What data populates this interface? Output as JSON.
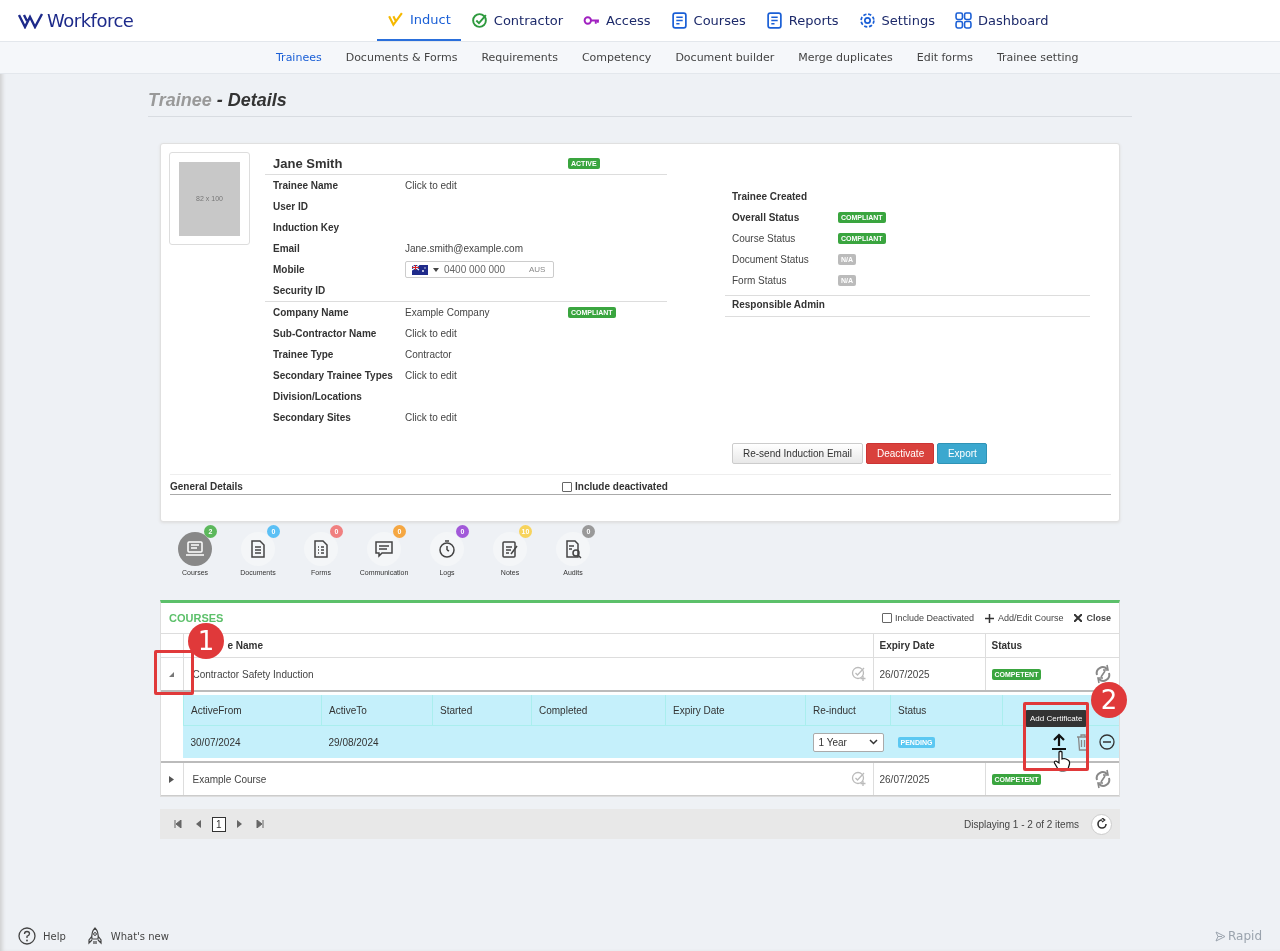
{
  "app": {
    "logo": "Workforce",
    "nav": [
      {
        "label": "Induct",
        "selected": true
      },
      {
        "label": "Contractor",
        "selected": false
      },
      {
        "label": "Access",
        "selected": false
      },
      {
        "label": "Courses",
        "selected": false
      },
      {
        "label": "Reports",
        "selected": false
      },
      {
        "label": "Settings",
        "selected": false
      },
      {
        "label": "Dashboard",
        "selected": false
      }
    ],
    "subnav": [
      {
        "label": "Trainees",
        "selected": true
      },
      {
        "label": "Documents & Forms",
        "selected": false
      },
      {
        "label": "Requirements",
        "selected": false
      },
      {
        "label": "Competency",
        "selected": false
      },
      {
        "label": "Document builder",
        "selected": false
      },
      {
        "label": "Merge duplicates",
        "selected": false
      },
      {
        "label": "Edit forms",
        "selected": false
      },
      {
        "label": "Trainee setting",
        "selected": false
      }
    ]
  },
  "page_title": {
    "main": "Trainee",
    "suffix": "- Details"
  },
  "profile": {
    "photo_placeholder": "82 x 100",
    "name": "Jane Smith",
    "status": "ACTIVE",
    "fields_primary": [
      {
        "label": "Trainee Name",
        "kind": "text",
        "value": "Click to edit"
      },
      {
        "label": "User ID",
        "kind": "text"
      },
      {
        "label": "Induction Key",
        "kind": "text"
      },
      {
        "label": "Email",
        "kind": "text",
        "value": "Jane.smith@example.com"
      },
      {
        "label": "Mobile",
        "kind": "phone",
        "placeholder": "0400 000 000",
        "country": "AUS"
      },
      {
        "label": "Security ID",
        "kind": "text"
      }
    ],
    "fields_secondary": [
      {
        "label": "Company Name",
        "value": "Example Company",
        "badge": "COMPLIANT"
      },
      {
        "label": "Sub-Contractor Name",
        "value": "Click to edit"
      },
      {
        "label": "Trainee Type",
        "value": "Contractor"
      },
      {
        "label": "Secondary Trainee Types",
        "value": "Click to edit"
      },
      {
        "label": "Division/Locations"
      },
      {
        "label": "Secondary Sites",
        "value": "Click to edit"
      }
    ],
    "statuses": [
      {
        "label": "Trainee Created",
        "bold": true
      },
      {
        "label": "Overall Status",
        "bold": true,
        "badge": "COMPLIANT",
        "color": "#3aa53f"
      },
      {
        "label": "Course Status",
        "bold": false,
        "badge": "COMPLIANT",
        "color": "#3aa53f"
      },
      {
        "label": "Document Status",
        "bold": false,
        "badge": "N/A",
        "color": "#bbbbbb"
      },
      {
        "label": "Form Status",
        "bold": false,
        "badge": "N/A",
        "color": "#bbbbbb"
      }
    ],
    "responsible_admin": "Responsible Admin",
    "buttons": [
      {
        "label": "Re-send Induction Email",
        "kind": "default"
      },
      {
        "label": "Deactivate",
        "kind": "danger"
      },
      {
        "label": "Export",
        "kind": "info"
      }
    ],
    "general_details": "General Details",
    "include_deactivated": {
      "label": "Include deactivated",
      "checked": false
    }
  },
  "tabs": [
    {
      "label": "Courses",
      "count": "2",
      "color": "#5cb85c",
      "selected": true
    },
    {
      "label": "Documents",
      "count": "0",
      "color": "#5bc0f5",
      "selected": false
    },
    {
      "label": "Forms",
      "count": "0",
      "color": "#f08080",
      "selected": false
    },
    {
      "label": "Communication",
      "count": "0",
      "color": "#f5a742",
      "selected": false
    },
    {
      "label": "Logs",
      "count": "0",
      "color": "#a259d9",
      "selected": false
    },
    {
      "label": "Notes",
      "count": "10",
      "color": "#f7d35c",
      "selected": false
    },
    {
      "label": "Audits",
      "count": "0",
      "color": "#999999",
      "selected": false
    }
  ],
  "courses": {
    "title": "COURSES",
    "include_deactivated": {
      "label": "Include Deactivated",
      "checked": false
    },
    "add_label": "Add/Edit Course",
    "close_label": "Close",
    "columns": [
      "e Name",
      "Expiry Date",
      "Status"
    ],
    "rows": [
      {
        "name": "Contractor Safety Induction",
        "expiry": "26/07/2025",
        "status": "COMPETENT",
        "expanded": true,
        "detail": {
          "columns": [
            "ActiveFrom",
            "ActiveTo",
            "Started",
            "Completed",
            "Expiry Date",
            "Re-induct",
            "Status"
          ],
          "row": {
            "active_from": "30/07/2024",
            "active_to": "29/08/2024",
            "reinduct": "1 Year",
            "status": "PENDING"
          },
          "tooltip": "Add Certificate"
        }
      },
      {
        "name": "Example Course",
        "expiry": "26/07/2025",
        "status": "COMPETENT",
        "expanded": false
      }
    ],
    "pager": {
      "page": "1",
      "summary": "Displaying 1 - 2 of 2 items"
    }
  },
  "callouts": [
    "1",
    "2"
  ],
  "footer": {
    "help": "Help",
    "whats_new": "What's new",
    "brand": "Rapid"
  }
}
